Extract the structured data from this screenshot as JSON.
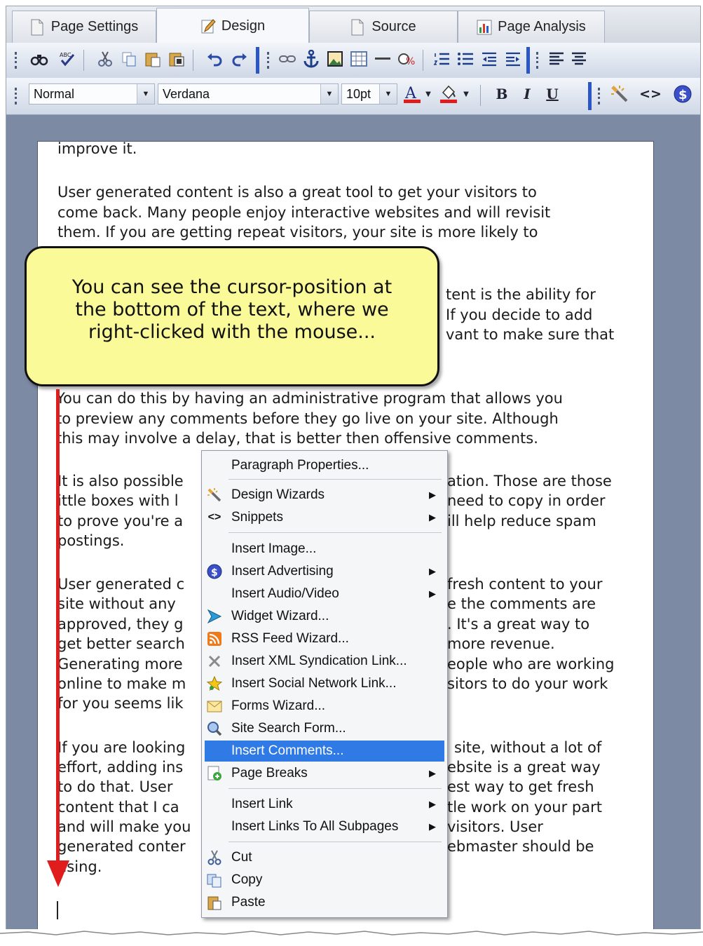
{
  "tabs": [
    {
      "label": "Page Settings",
      "icon": "page-icon",
      "active": false
    },
    {
      "label": "Design",
      "icon": "pencil-icon",
      "active": true
    },
    {
      "label": "Source",
      "icon": "document-icon",
      "active": false
    },
    {
      "label": "Page Analysis",
      "icon": "bar-chart-icon",
      "active": false
    }
  ],
  "format_bar": {
    "style": "Normal",
    "font": "Verdana",
    "size": "10pt",
    "bold": "B",
    "italic": "I",
    "underline": "U",
    "snippet": "<>"
  },
  "document": {
    "paragraphs": [
      "improve it.",
      "User generated content is also a great tool to get your visitors to\ncome back. Many people enjoy interactive websites and will revisit\nthem. If you are getting repeat visitors, your site is more likely to",
      "tent is the ability for\n If you decide to add\nvant to make sure that",
      "You can do this by having an administrative program that allows you\nto preview any comments before they go live on your site. Although\nthis may involve a delay, that is better then offensive comments.",
      "It is also possible",
      "ation. Those are those",
      "ittle boxes with l",
      "need to copy in order",
      "to prove you're a",
      "ill help reduce spam",
      "postings.",
      "User generated c",
      "fresh content to your",
      "site without any",
      "e the comments are",
      "approved, they g",
      ". It's a great way to",
      "get better search",
      "more revenue.",
      "Generating more",
      "eople who are working",
      "online to make m",
      "sitors to do your work",
      "for you seems lik",
      "If you are looking",
      "site, without a lot of",
      "effort, adding ins",
      "ebsite is a great way",
      "to do that. User",
      "est way to get fresh",
      "content that I ca",
      "tle work on your part",
      "and will make you",
      "visitors. User",
      "generated conter",
      "ebmaster should be",
      "using."
    ]
  },
  "callout": {
    "text": "You can see the cursor-position at\nthe bottom of the text, where we\nright-clicked with the mouse..."
  },
  "context_menu": {
    "items": [
      {
        "label": "Paragraph Properties...",
        "icon": "",
        "submenu": false
      },
      {
        "label": "Design Wizards",
        "icon": "wand-icon",
        "submenu": true
      },
      {
        "label": "Snippets",
        "icon": "code-icon",
        "submenu": true
      },
      {
        "label": "Insert Image...",
        "icon": "",
        "submenu": false
      },
      {
        "label": "Insert Advertising",
        "icon": "dollar-icon",
        "submenu": true
      },
      {
        "label": "Insert Audio/Video",
        "icon": "",
        "submenu": true
      },
      {
        "label": "Widget Wizard...",
        "icon": "widget-icon",
        "submenu": false
      },
      {
        "label": "RSS Feed Wizard...",
        "icon": "rss-icon",
        "submenu": false
      },
      {
        "label": "Insert XML Syndication Link...",
        "icon": "xml-icon",
        "submenu": false
      },
      {
        "label": "Insert Social Network Link...",
        "icon": "star-icon",
        "submenu": false
      },
      {
        "label": "Forms Wizard...",
        "icon": "form-icon",
        "submenu": false
      },
      {
        "label": "Site Search Form...",
        "icon": "search-icon",
        "submenu": false
      },
      {
        "label": "Insert Comments...",
        "icon": "",
        "submenu": false,
        "highlighted": true
      },
      {
        "label": "Page Breaks",
        "icon": "page-break-icon",
        "submenu": true
      },
      {
        "label": "Insert Link",
        "icon": "",
        "submenu": true
      },
      {
        "label": "Insert Links To All Subpages",
        "icon": "",
        "submenu": true
      },
      {
        "label": "Cut",
        "icon": "scissors-icon",
        "submenu": false
      },
      {
        "label": "Copy",
        "icon": "copy-icon",
        "submenu": false
      },
      {
        "label": "Paste",
        "icon": "paste-icon",
        "submenu": false
      }
    ]
  },
  "colors": {
    "highlight": "#2f7ae5",
    "arrow": "#e01d1d",
    "callout_bg": "#fafa99",
    "workspace": "#7d8aa3"
  }
}
